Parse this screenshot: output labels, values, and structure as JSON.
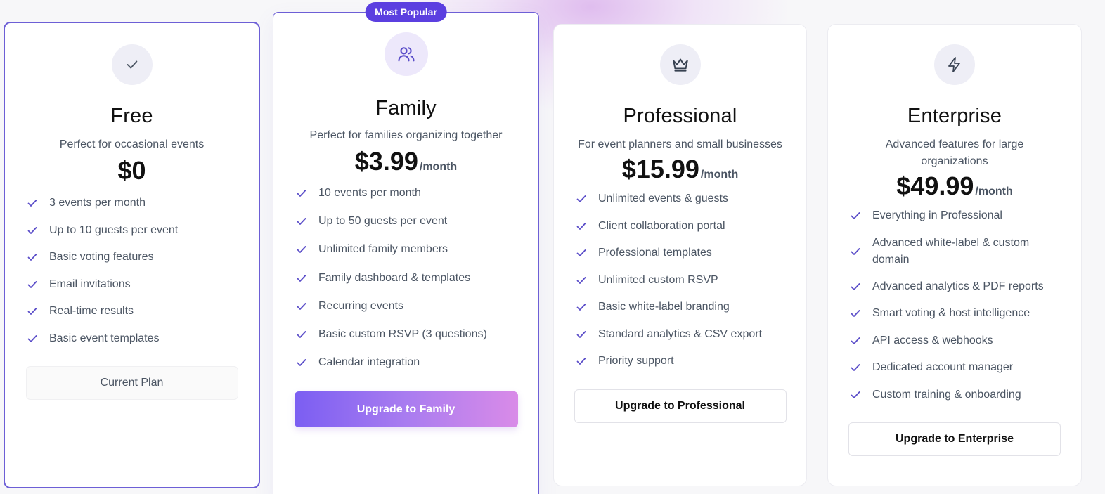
{
  "plans": [
    {
      "name": "Free",
      "subtitle": "Perfect for occasional events",
      "price": "$0",
      "period": "",
      "icon": "check-icon",
      "features": [
        "3 events per month",
        "Up to 10 guests per event",
        "Basic voting features",
        "Email invitations",
        "Real-time results",
        "Basic event templates"
      ],
      "button_label": "Current Plan"
    },
    {
      "name": "Family",
      "badge": "Most Popular",
      "subtitle": "Perfect for families organizing together",
      "price": "$3.99",
      "period": "/month",
      "icon": "users-icon",
      "features": [
        "10 events per month",
        "Up to 50 guests per event",
        "Unlimited family members",
        "Family dashboard & templates",
        "Recurring events",
        "Basic custom RSVP (3 questions)",
        "Calendar integration"
      ],
      "button_label": "Upgrade to Family"
    },
    {
      "name": "Professional",
      "subtitle": "For event planners and small businesses",
      "price": "$15.99",
      "period": "/month",
      "icon": "crown-icon",
      "features": [
        "Unlimited events & guests",
        "Client collaboration portal",
        "Professional templates",
        "Unlimited custom RSVP",
        "Basic white-label branding",
        "Standard analytics & CSV export",
        "Priority support"
      ],
      "button_label": "Upgrade to Professional"
    },
    {
      "name": "Enterprise",
      "subtitle": "Advanced features for large organizations",
      "price": "$49.99",
      "period": "/month",
      "icon": "lightning-icon",
      "features": [
        "Everything in Professional",
        "Advanced white-label & custom domain",
        "Advanced analytics & PDF reports",
        "Smart voting & host intelligence",
        "API access & webhooks",
        "Dedicated account manager",
        "Custom training & onboarding"
      ],
      "button_label": "Upgrade to Enterprise"
    }
  ],
  "colors": {
    "accent": "#6d5fd6",
    "badge": "#5b3fe0",
    "check": "#5b4ec9",
    "gradient_start": "#7b5ef2",
    "gradient_end": "#d98be8"
  }
}
